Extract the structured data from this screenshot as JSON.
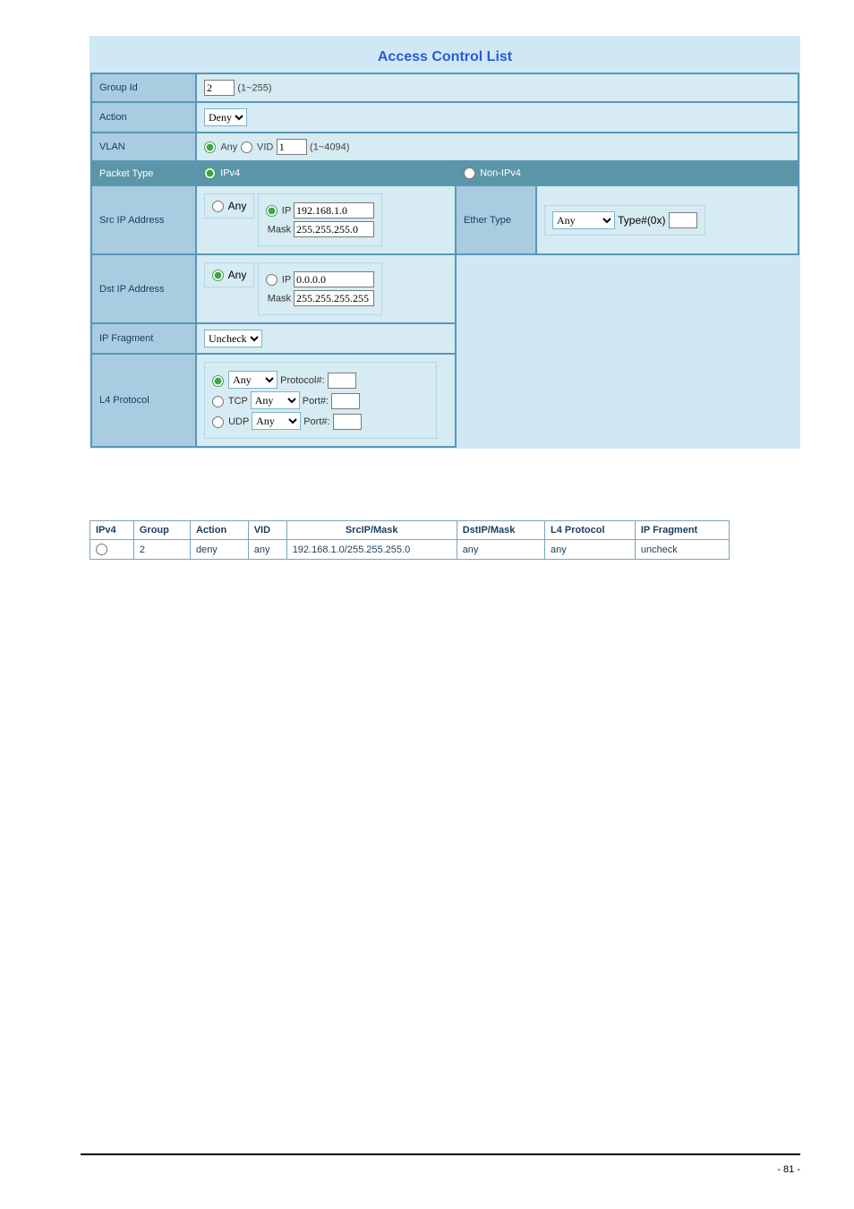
{
  "title": "Access Control List",
  "form": {
    "group_id": {
      "label": "Group Id",
      "value": "2",
      "hint": "(1~255)"
    },
    "action": {
      "label": "Action",
      "value": "Deny"
    },
    "vlan": {
      "label": "VLAN",
      "any_label": "Any",
      "vid_label": "VID",
      "vid_value": "1",
      "hint": "(1~4094)"
    },
    "packet_type": {
      "label": "Packet Type",
      "ipv4_label": "IPv4",
      "non_ipv4_label": "Non-IPv4"
    },
    "src_ip": {
      "label": "Src IP Address",
      "any_label": "Any",
      "ip_label": "IP",
      "ip_value": "192.168.1.0",
      "mask_label": "Mask",
      "mask_value": "255.255.255.0"
    },
    "ether": {
      "label": "Ether Type",
      "sel_value": "Any",
      "type_label": "Type#(0x)",
      "type_value": ""
    },
    "dst_ip": {
      "label": "Dst IP Address",
      "any_label": "Any",
      "ip_label": "IP",
      "ip_value": "0.0.0.0",
      "mask_label": "Mask",
      "mask_value": "255.255.255.255"
    },
    "ip_frag": {
      "label": "IP Fragment",
      "value": "Uncheck"
    },
    "l4": {
      "label": "L4 Protocol",
      "any_sel": "Any",
      "proto_label": "Protocol#:",
      "proto_value": "",
      "tcp_label": "TCP",
      "tcp_sel": "Any",
      "tcp_port_label": "Port#:",
      "tcp_port_value": "",
      "udp_label": "UDP",
      "udp_sel": "Any",
      "udp_port_label": "Port#:",
      "udp_port_value": ""
    }
  },
  "result": {
    "headers": [
      "IPv4",
      "Group",
      "Action",
      "VID",
      "SrcIP/Mask",
      "DstIP/Mask",
      "L4 Protocol",
      "IP Fragment"
    ],
    "row": {
      "group": "2",
      "action": "deny",
      "vid": "any",
      "src": "192.168.1.0/255.255.255.0",
      "dst": "any",
      "l4": "any",
      "frag": "uncheck"
    }
  },
  "page_num": "- 81 -"
}
